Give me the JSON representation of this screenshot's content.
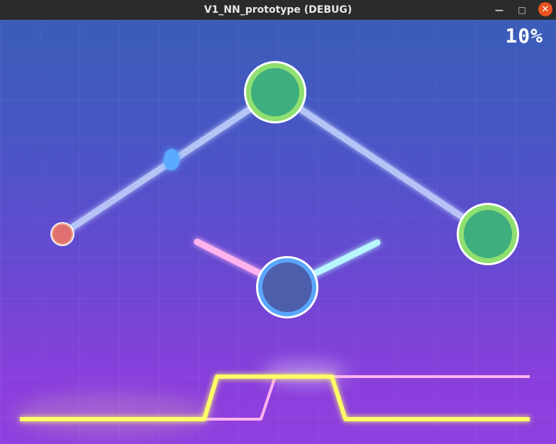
{
  "window": {
    "title": "V1_NN_prototype (DEBUG)",
    "minimize_glyph": "—",
    "maximize_glyph": "□",
    "close_glyph": "✕"
  },
  "hud": {
    "progress": "10%"
  },
  "colors": {
    "node_green_fill": "#3fae7e",
    "node_green_ring": "#8fe070",
    "node_blue_fill": "#4d5faa",
    "node_blue_ring": "#5aa6ff",
    "node_red_fill": "#e07070",
    "connection": "#c8d8ff",
    "pink_wire": "#ffb4ef",
    "cyan_wire": "#b8f6ff",
    "signal": "#ffff66",
    "pulse": "#5aaaff"
  }
}
